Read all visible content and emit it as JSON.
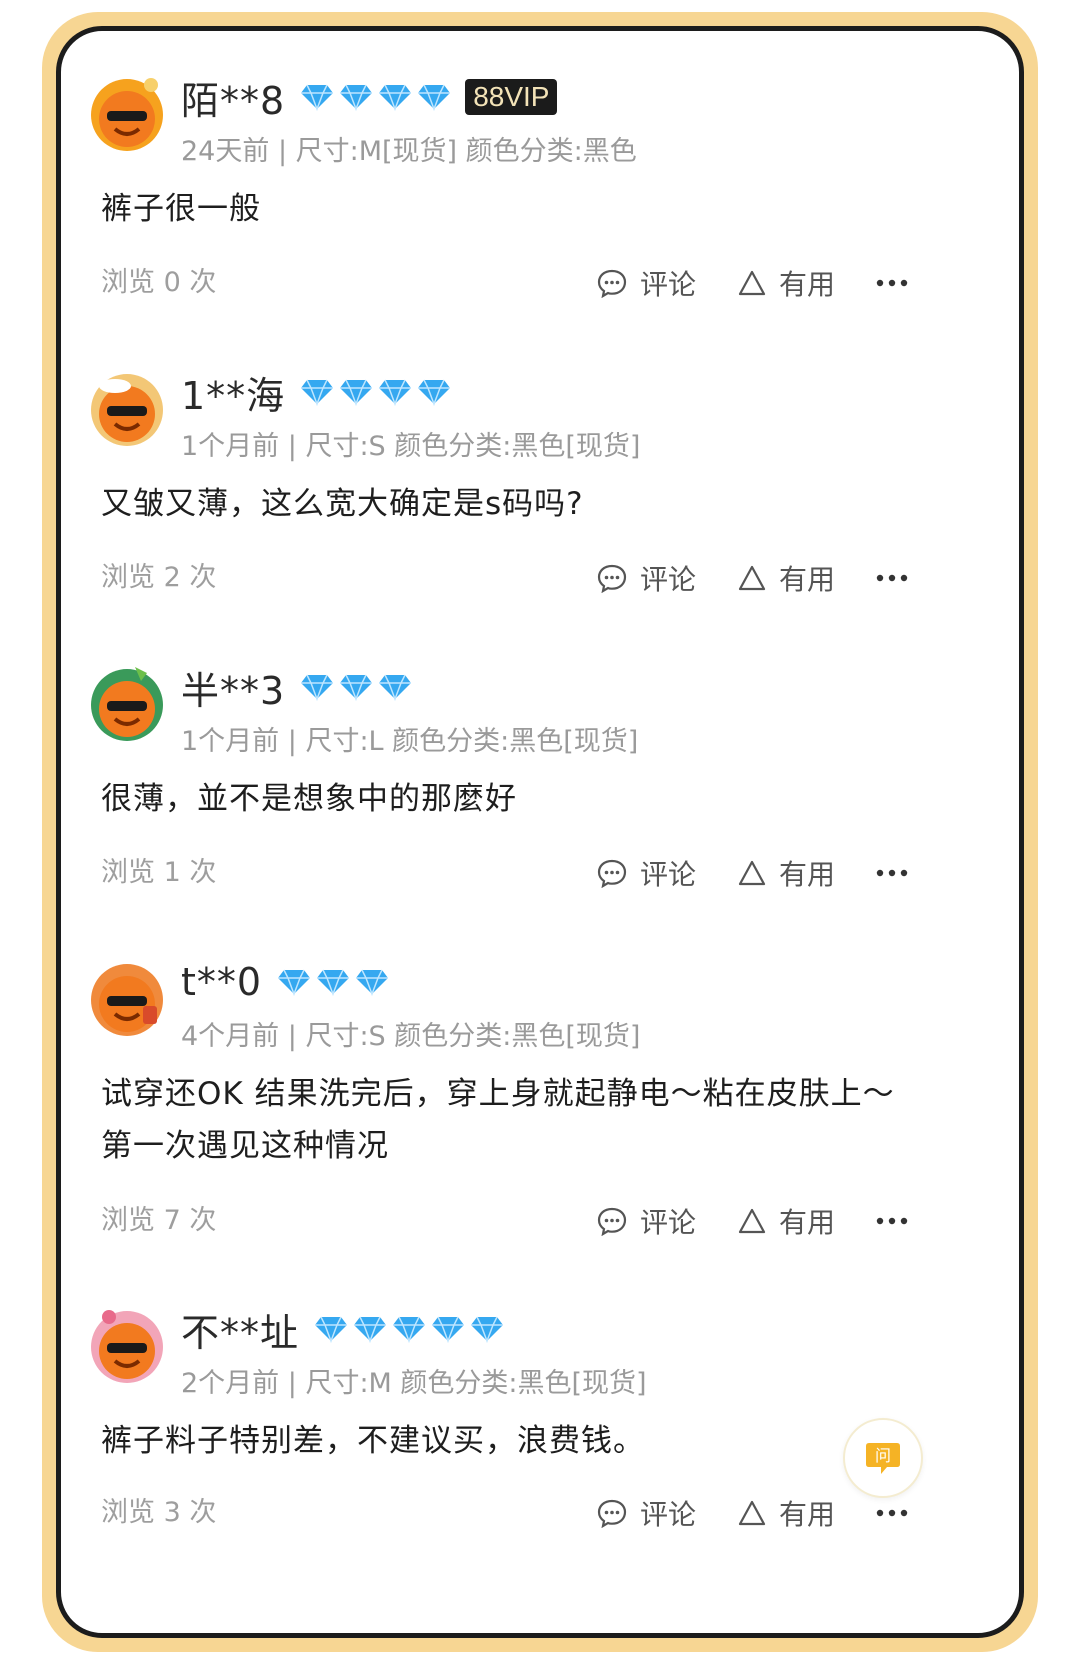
{
  "colors": {
    "frame": "#f7d693",
    "diamond": "#35a8f0",
    "vip_bg": "#1b1b1b",
    "vip_text": "#f3e3b8"
  },
  "actions": {
    "comment_label": "评论",
    "useful_label": "有用",
    "more_icon": "more-dots-icon"
  },
  "reviews": [
    {
      "username": "陌**8",
      "diamonds": 4,
      "vip": "88VIP",
      "meta": "24天前 | 尺寸:M[现货] 颜色分类:黑色",
      "content": "裤子很一般",
      "views": "浏览 0 次"
    },
    {
      "username": "1**海",
      "diamonds": 4,
      "vip": "",
      "meta": "1个月前 | 尺寸:S 颜色分类:黑色[现货]",
      "content": "又皱又薄，这么宽大确定是s码吗?",
      "views": "浏览 2 次"
    },
    {
      "username": "半**3",
      "diamonds": 3,
      "vip": "",
      "meta": "1个月前 | 尺寸:L 颜色分类:黑色[现货]",
      "content": "很薄，並不是想象中的那麼好",
      "views": "浏览 1 次"
    },
    {
      "username": "t**0",
      "diamonds": 3,
      "vip": "",
      "meta": "4个月前 | 尺寸:S 颜色分类:黑色[现货]",
      "content_line1": "试穿还OK 结果洗完后，穿上身就起静电～粘在皮肤上～",
      "content_line2": "第一次遇见这种情况",
      "views": "浏览 7 次"
    },
    {
      "username": "不**址",
      "diamonds": 5,
      "vip": "",
      "meta": "2个月前 | 尺寸:M 颜色分类:黑色[现货]",
      "content": "裤子料子特别差，不建议买，浪费钱。",
      "views": "浏览 3 次"
    }
  ],
  "float_button": {
    "icon": "question-chat-icon",
    "label": "问"
  }
}
